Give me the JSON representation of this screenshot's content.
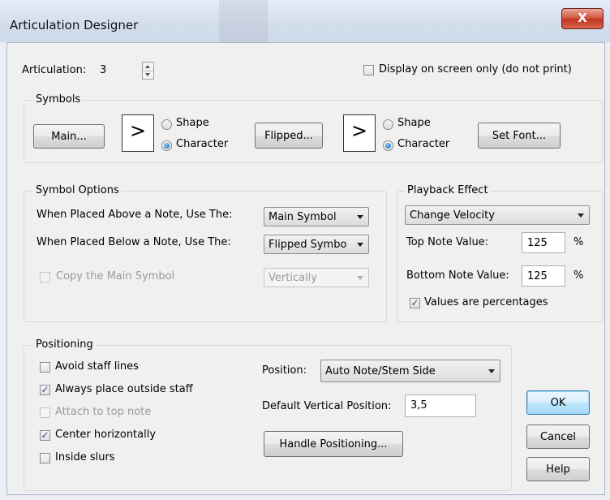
{
  "window": {
    "title": "Articulation Designer",
    "close_glyph": "X"
  },
  "articulation": {
    "label": "Articulation:",
    "value": "3"
  },
  "display_only": {
    "label": "Display on screen only (do not print)",
    "checked": false
  },
  "symbols": {
    "title": "Symbols",
    "main_button": "Main...",
    "main_preview": ">",
    "shape_label": "Shape",
    "character_label": "Character",
    "flipped_button": "Flipped...",
    "flipped_preview": ">",
    "set_font_button": "Set Font..."
  },
  "symbol_options": {
    "title": "Symbol Options",
    "above_label": "When Placed Above a Note, Use The:",
    "above_value": "Main Symbol",
    "below_label": "When Placed Below a Note, Use The:",
    "below_value": "Flipped Symbo",
    "copy_label": "Copy the Main Symbol",
    "copy_direction": "Vertically"
  },
  "playback": {
    "title": "Playback Effect",
    "effect": "Change Velocity",
    "top_label": "Top Note Value:",
    "top_value": "125",
    "bottom_label": "Bottom Note Value:",
    "bottom_value": "125",
    "percent": "%",
    "percentages_label": "Values are percentages"
  },
  "positioning": {
    "title": "Positioning",
    "avoid_staff": "Avoid staff lines",
    "always_outside": "Always place outside staff",
    "attach_top": "Attach to top note",
    "center_horiz": "Center horizontally",
    "inside_slurs": "Inside slurs",
    "position_label": "Position:",
    "position_value": "Auto Note/Stem Side",
    "default_vertical_label": "Default Vertical Position:",
    "default_vertical_value": "3,5",
    "handle_button": "Handle Positioning..."
  },
  "buttons": {
    "ok": "OK",
    "cancel": "Cancel",
    "help": "Help"
  },
  "check_glyph": "✓"
}
